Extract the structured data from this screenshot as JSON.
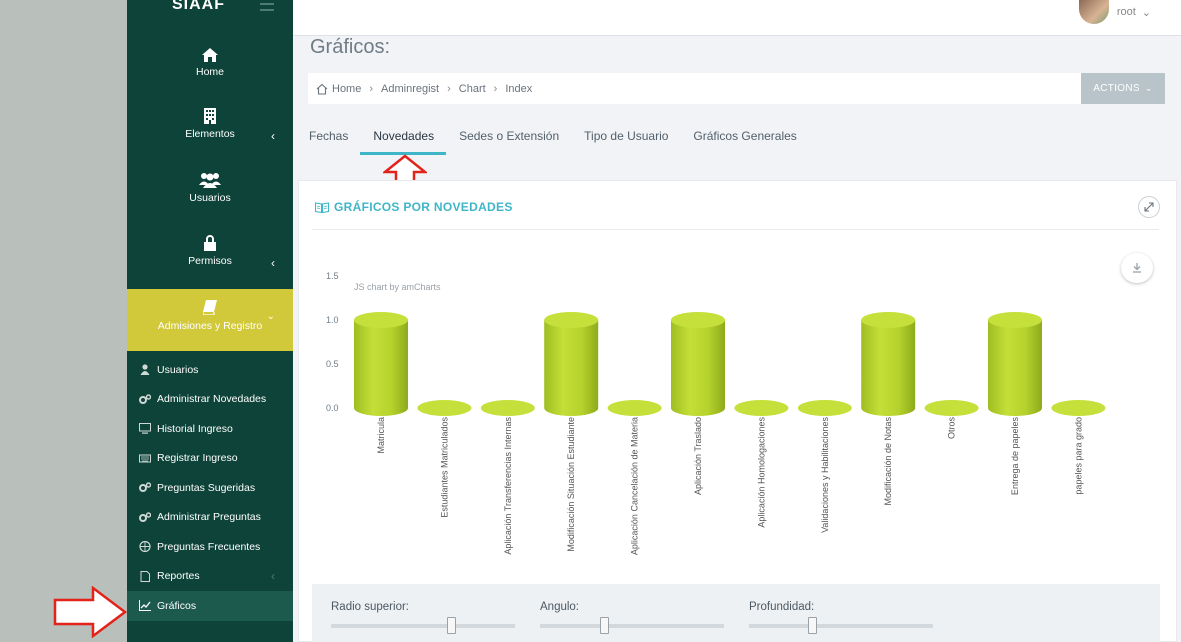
{
  "sidebar": {
    "brand": "SIAAF",
    "nav": [
      {
        "label": "Home",
        "icon": "home-icon"
      },
      {
        "label": "Elementos",
        "icon": "building-icon"
      },
      {
        "label": "Usuarios",
        "icon": "users-icon"
      },
      {
        "label": "Permisos",
        "icon": "lock-icon"
      },
      {
        "label": "Admisiones y Registro",
        "icon": "book-icon"
      }
    ],
    "sub": [
      {
        "label": "Usuarios",
        "icon": "user-icon"
      },
      {
        "label": "Administrar Novedades",
        "icon": "cogs-icon"
      },
      {
        "label": "Historial Ingreso",
        "icon": "desktop-icon"
      },
      {
        "label": "Registrar Ingreso",
        "icon": "keyboard-icon"
      },
      {
        "label": "Preguntas Sugeridas",
        "icon": "cogs-icon"
      },
      {
        "label": "Administrar Preguntas",
        "icon": "cogs-icon"
      },
      {
        "label": "Preguntas Frecuentes",
        "icon": "globe-icon"
      },
      {
        "label": "Reportes",
        "icon": "file-icon"
      },
      {
        "label": "Gráficos",
        "icon": "line-chart-icon"
      }
    ],
    "accent": "#d1c83a",
    "background": "#0e4339"
  },
  "topbar": {
    "user": "root"
  },
  "page": {
    "title": "Gráficos:",
    "breadcrumb": [
      "Home",
      "Adminregist",
      "Chart",
      "Index"
    ],
    "actions_label": "ACTIONS"
  },
  "tabs": [
    "Fechas",
    "Novedades",
    "Sedes o Extensión",
    "Tipo de Usuario",
    "Gráficos Generales"
  ],
  "active_tab": "Novedades",
  "panel": {
    "title": "GRÁFICOS POR NOVEDADES",
    "credit": "JS chart by amCharts"
  },
  "chart_data": {
    "type": "bar",
    "style": "3d-cylinder",
    "categories": [
      "Matricula",
      "Estudiantes Matriculados",
      "Aplicación Transferencias Internas",
      "Modificación Situación Estudiante",
      "Aplicación Cancelación de Materia",
      "Aplicación Traslado",
      "Aplicación Homologaciones",
      "Validaciones y Habilitaciones",
      "Modificación de Notas",
      "Otros",
      "Entrega de papeles",
      "papeles para grado"
    ],
    "values": [
      1,
      0,
      0,
      1,
      0,
      1,
      0,
      0,
      1,
      0,
      1,
      0
    ],
    "y_ticks": [
      "0.0",
      "0.5",
      "1.0",
      "1.5"
    ],
    "ylim": [
      0,
      1.5
    ],
    "bar_color": "#c5e03a"
  },
  "controls": [
    {
      "label": "Radio superior:",
      "value": 0.65
    },
    {
      "label": "Angulo:",
      "value": 0.35
    },
    {
      "label": "Profundidad:",
      "value": 0.34
    }
  ]
}
